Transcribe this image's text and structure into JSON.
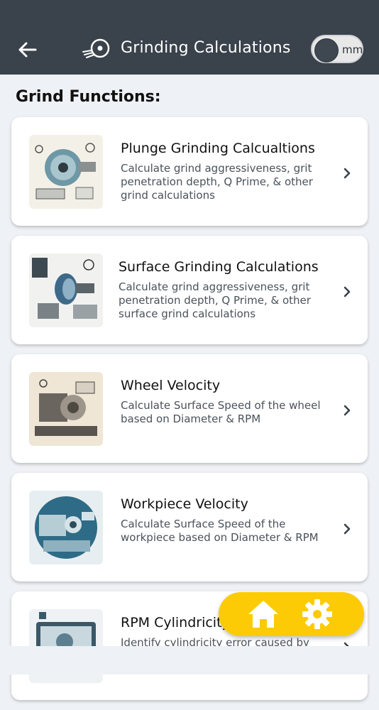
{
  "header": {
    "title": "Grinding Calculations",
    "back_icon": "arrow-left-icon",
    "logo_icon": "grinding-wheel-icon",
    "unit_toggle_label": "mm",
    "background": "#3a424c"
  },
  "section_title": "Grind Functions:",
  "cards": [
    {
      "title": "Plunge Grinding Calcualtions",
      "description": "Calculate grind aggressiveness, grit penetration depth, Q Prime, & other grind calculations",
      "image_icon": "plunge-grinder-illustration"
    },
    {
      "title": "Surface Grinding Calculations",
      "description": "Calculate grind aggressiveness, grit penetration depth, Q Prime, & other surface grind calculations",
      "image_icon": "surface-grinder-illustration"
    },
    {
      "title": "Wheel Velocity",
      "description": "Calculate Surface Speed of the wheel based on Diameter & RPM",
      "image_icon": "wheel-velocity-illustration"
    },
    {
      "title": "Workpiece Velocity",
      "description": "Calculate Surface Speed of the workpiece  based on Diameter & RPM",
      "image_icon": "workpiece-velocity-illustration"
    },
    {
      "title": "RPM Cylindricity",
      "description": "Identify cylindricity error caused by",
      "image_icon": "cylindricity-illustration"
    }
  ],
  "fab": {
    "home_icon": "home-icon",
    "settings_icon": "gear-icon",
    "color": "#fccb05"
  }
}
